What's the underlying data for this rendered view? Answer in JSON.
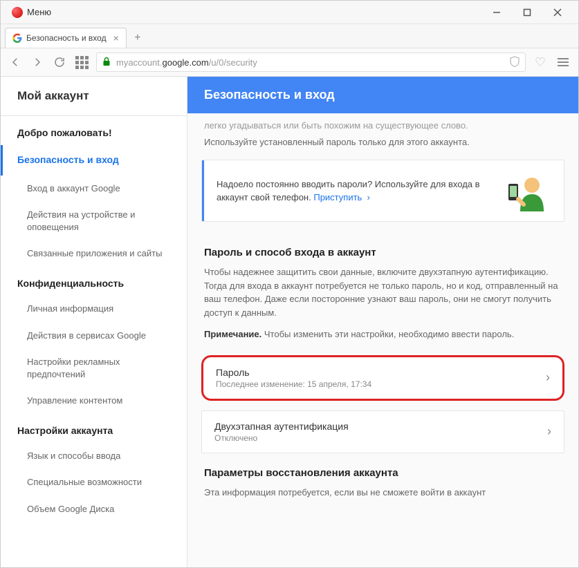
{
  "titlebar": {
    "menu_label": "Меню"
  },
  "tab": {
    "title": "Безопасность и вход"
  },
  "url": {
    "prefix": "myaccount.",
    "domain": "google.com",
    "path": "/u/0/security"
  },
  "sidebar": {
    "account_header": "Мой аккаунт",
    "welcome": "Добро пожаловать!",
    "security_nav": "Безопасность и вход",
    "security_items": [
      "Вход в аккаунт Google",
      "Действия на устройстве и оповещения",
      "Связанные приложения и сайты"
    ],
    "privacy_nav": "Конфиденциальность",
    "privacy_items": [
      "Личная информация",
      "Действия в сервисах Google",
      "Настройки рекламных предпочтений",
      "Управление контентом"
    ],
    "account_settings_nav": "Настройки аккаунта",
    "account_items": [
      "Язык и способы ввода",
      "Специальные возможности",
      "Объем Google Диска"
    ]
  },
  "main": {
    "header": "Безопасность и вход",
    "faded1": "легко угадываться или быть похожим на существующее слово.",
    "faded2": "Используйте установленный пароль только для этого аккаунта.",
    "banner_text": "Надоело постоянно вводить пароли? Используйте для входа в аккаунт свой телефон. ",
    "banner_link": "Приступить",
    "password_section_title": "Пароль и способ входа в аккаунт",
    "password_desc": "Чтобы надежнее защитить свои данные, включите двухэтапную аутентификацию. Тогда для входа в аккаунт потребуется не только пароль, но и код, отправленный на ваш телефон. Даже если посторонние узнают ваш пароль, они не смогут получить доступ к данным.",
    "note_label": "Примечание.",
    "note_text": " Чтобы изменить эти настройки, необходимо ввести пароль.",
    "password_row_title": "Пароль",
    "password_row_sub": "Последнее изменение: 15 апреля, 17:34",
    "twofa_row_title": "Двухэтапная аутентификация",
    "twofa_row_sub": "Отключено",
    "recovery_title": "Параметры восстановления аккаунта",
    "recovery_desc": "Эта информация потребуется, если вы не сможете войти в аккаунт"
  }
}
